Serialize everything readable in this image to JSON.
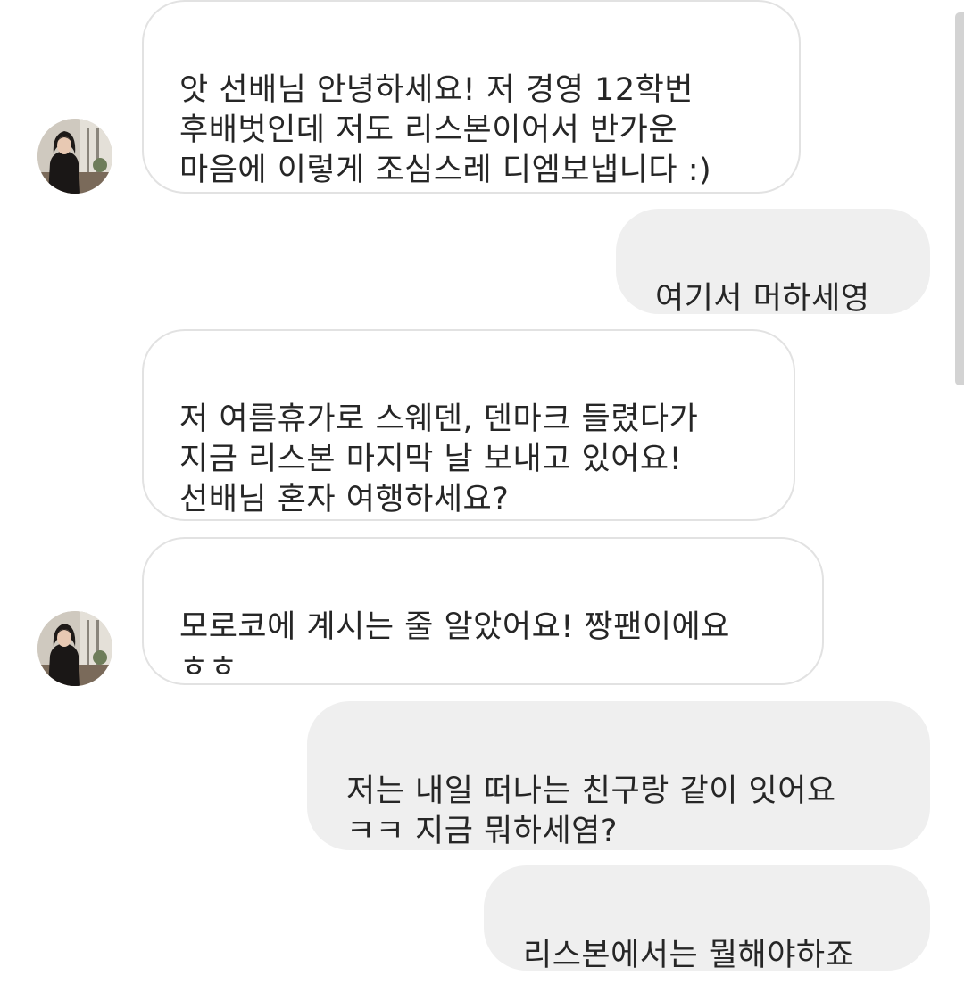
{
  "messages": [
    {
      "sender": "other",
      "text": "앗 선배님 안녕하세요! 저 경영 12학번\n후배벗인데 저도 리스본이어서 반가운\n마음에 이렇게 조심스레 디엠보냅니다 :)"
    },
    {
      "sender": "me",
      "text": "여기서 머하세영"
    },
    {
      "sender": "other",
      "text": "저 여름휴가로 스웨덴, 덴마크 들렸다가\n지금 리스본 마지막 날 보내고 있어요!\n선배님 혼자 여행하세요?"
    },
    {
      "sender": "other",
      "text": "모로코에 계시는 줄 알았어요! 짱팬이에요\nㅎㅎ"
    },
    {
      "sender": "me",
      "text": "저는 내일 떠나는 친구랑 같이 잇어요\nㅋㅋ 지금 뭐하세염?"
    },
    {
      "sender": "me",
      "text": "리스본에서는 뭘해야하죠"
    }
  ],
  "colors": {
    "incoming_bg": "#ffffff",
    "incoming_border": "#e2e2e2",
    "outgoing_bg": "#efefef",
    "text": "#262626"
  },
  "icons": {
    "avatar": "profile-photo"
  }
}
